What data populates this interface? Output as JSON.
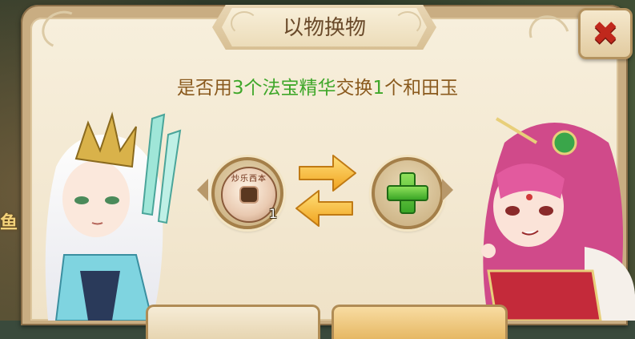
{
  "dialog": {
    "title": "以物换物",
    "prompt": {
      "p1": "是否用",
      "n1": "3",
      "p2": "个",
      "item_given": "法宝精华",
      "p3": "交换",
      "n2": "1",
      "p4": "个",
      "item_received": "和田玉"
    },
    "given_item": {
      "count": "1",
      "inscription": "炒乐西本",
      "icon": "jade-coin-icon"
    },
    "target_item": {
      "icon": "plus-icon"
    },
    "exchange_icon": "exchange-arrows-icon",
    "close_icon": "close-icon"
  },
  "background": {
    "side_text": "鱼"
  },
  "colors": {
    "prompt_text": "#8a5a1e",
    "highlight_text": "#3fa72a",
    "close_x": "#c0281c",
    "panel": "#f5ecd6"
  }
}
